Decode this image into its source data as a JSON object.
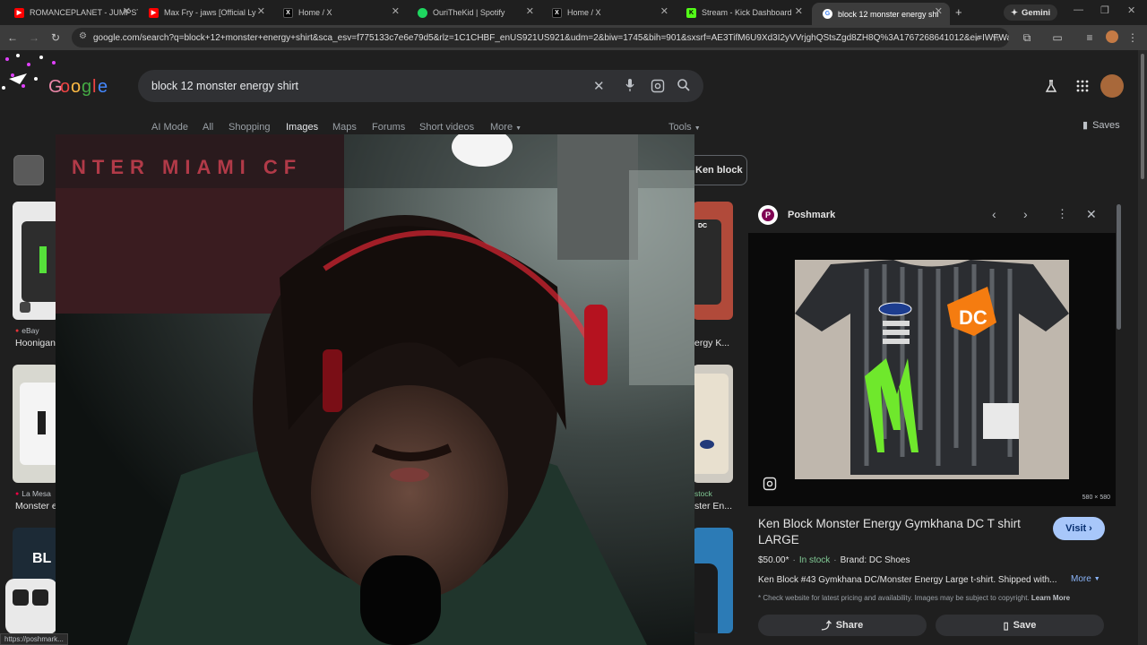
{
  "tabs": [
    {
      "title": "ROMANCEPLANET - JUMPST",
      "icon": "youtube-icon",
      "color": "#ff0000"
    },
    {
      "title": "Max Fry - jaws [Official Ly",
      "icon": "youtube-icon",
      "color": "#ff0000"
    },
    {
      "title": "Home / X",
      "icon": "x-icon",
      "color": "#000000"
    },
    {
      "title": "OuriTheKid | Spotify",
      "icon": "spotify-icon",
      "color": "#1ed760"
    },
    {
      "title": "Home / X",
      "icon": "x-icon",
      "color": "#000000"
    },
    {
      "title": "Stream - Kick Dashboard",
      "icon": "kick-icon",
      "color": "#53fc18"
    },
    {
      "title": "block 12 monster energy shi",
      "icon": "google-icon",
      "color": "#ffffff",
      "active": true
    }
  ],
  "gemini_label": "Gemini",
  "url": "google.com/search?q=block+12+monster+energy+shirt&sca_esv=f775133c7e6e79d5&rlz=1C1CHBF_enUS921US921&udm=2&biw=1745&bih=901&sxsrf=AE3TifM6U9Xd3I2yVVrjghQStsZgd8ZH8Q%3A1767268641012&ei=IWFWabs_...",
  "search": {
    "query": "block 12 monster energy shirt"
  },
  "nav_tabs": [
    "AI Mode",
    "All",
    "Shopping",
    "Images",
    "Maps",
    "Forums",
    "Short videos",
    "More"
  ],
  "selected_tab": "Images",
  "tools_label": "Tools",
  "saves_label": "Saves",
  "chip_label": "Ken block",
  "left_results": [
    {
      "source": "eBay",
      "title": "Hoonigan"
    },
    {
      "source": "La Mesa",
      "title": "Monster e"
    }
  ],
  "right_results": [
    {
      "title": "ergy K..."
    },
    {
      "source": "stock",
      "title": "ster En..."
    }
  ],
  "panel": {
    "source": "Poshmark",
    "image_size": "580 × 580",
    "title": "Ken Block Monster Energy Gymkhana DC T shirt LARGE",
    "visit_label": "Visit",
    "price": "$50.00*",
    "stock": "In stock",
    "brand": "Brand: DC Shoes",
    "description": "Ken Block #43 Gymkhana DC/Monster Energy Large t-shirt. Shipped with...",
    "more_label": "More",
    "disclaimer": "* Check website for latest pricing and availability. Images may be subject to copyright.",
    "learn_more": "Learn More",
    "share_label": "Share",
    "save_label": "Save"
  },
  "status_url": "https://poshmark...",
  "webcam_sign": "NTER MIAMI CF",
  "colors": {
    "accent": "#8ab4f8",
    "stock_green": "#81c995",
    "visit_bg": "#a8c7fa"
  }
}
